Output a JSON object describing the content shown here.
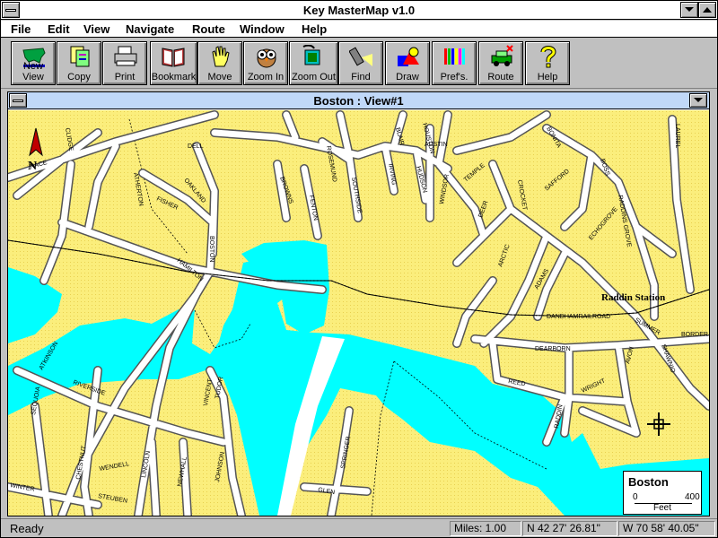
{
  "app": {
    "title": "Key MasterMap v1.0"
  },
  "menu": [
    "File",
    "Edit",
    "View",
    "Navigate",
    "Route",
    "Window",
    "Help"
  ],
  "toolbar": [
    {
      "label": "New View",
      "icon": "usa-map-icon"
    },
    {
      "label": "Copy",
      "icon": "copy-icon"
    },
    {
      "label": "Print",
      "icon": "printer-icon"
    },
    {
      "label": "Bookmark",
      "icon": "book-icon"
    },
    {
      "label": "Move",
      "icon": "hand-icon"
    },
    {
      "label": "Zoom In",
      "icon": "owl-icon"
    },
    {
      "label": "Zoom Out",
      "icon": "zoom-out-icon"
    },
    {
      "label": "Find",
      "icon": "flashlight-icon"
    },
    {
      "label": "Draw",
      "icon": "shapes-icon"
    },
    {
      "label": "Pref's.",
      "icon": "crayons-icon"
    },
    {
      "label": "Route",
      "icon": "car-icon"
    },
    {
      "label": "Help",
      "icon": "question-icon"
    }
  ],
  "view": {
    "title": "Boston : View#1"
  },
  "map": {
    "north_label": "N",
    "station_label": "Raddin Station",
    "streets": [
      "NACE",
      "CLIDGE",
      "DELL",
      "OAKLAND",
      "ATHERTON",
      "FISHER",
      "HAMILTON",
      "BOSTON",
      "BROWNS",
      "FENTON",
      "ROSEMUND",
      "SOUTHSIDE",
      "BLAIR",
      "HOUSTON",
      "IRVING",
      "HUDSON",
      "AUSTIN",
      "WINDSOR",
      "TEMPLE",
      "DEER",
      "CROCKET",
      "SAFFORD",
      "BONITA",
      "BOSS",
      "RADDINS GROVE",
      "LAUREL",
      "ECHOGROVE",
      "ARCTIC",
      "ADAMS",
      "DANDHAMRAILROAD",
      "SUMMER",
      "SHAWNIO",
      "BORDER",
      "DEARBORN",
      "REED",
      "AVON",
      "WRIGHT",
      "RADDIN",
      "ATKINSON",
      "RIVERSIDE",
      "SEQUOIA",
      "VINCENT",
      "TUDOR",
      "LINCOLN",
      "JOHNSON",
      "NEWHALL",
      "WENDELL",
      "CHESTNUT",
      "STEUBEN",
      "WINTER",
      "SPRINGER",
      "GLEN"
    ],
    "legend": {
      "city": "Boston",
      "scale_start": "0",
      "scale_end": "400",
      "unit": "Feet"
    }
  },
  "status": {
    "ready": "Ready",
    "miles": "Miles: 1.00",
    "lat": "N 42 27' 26.81\"",
    "lon": "W 70 58' 40.05\""
  },
  "colors": {
    "land": "#fbee7c",
    "water": "#00ffff",
    "road": "#ffffff",
    "window_title": "#c0d8f8"
  }
}
